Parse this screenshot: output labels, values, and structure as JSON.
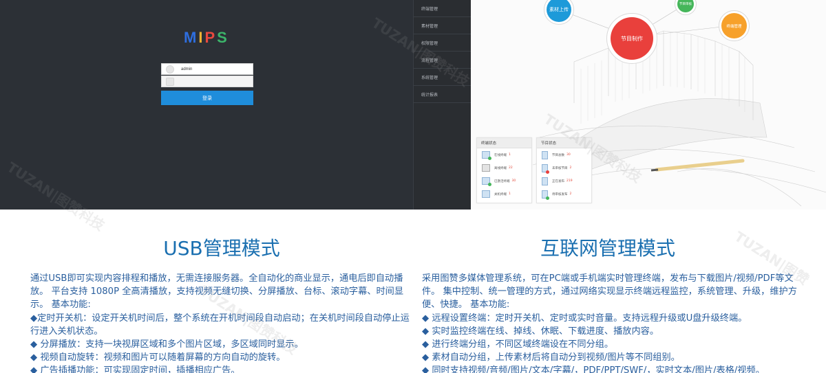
{
  "login": {
    "logo_letters": [
      "M",
      "I",
      "P",
      "S"
    ],
    "logo_colors": [
      "#2e6ee0",
      "#f2b233",
      "#e8493f",
      "#3cb56a"
    ],
    "username_value": "admin",
    "password_value": "",
    "login_button_label": "登录"
  },
  "side_menu": {
    "items": [
      {
        "label": "终端管理"
      },
      {
        "label": "素材管理"
      },
      {
        "label": "权限管理"
      },
      {
        "label": "流程管理"
      },
      {
        "label": "系统管理"
      },
      {
        "label": "统计报表"
      }
    ]
  },
  "dashboard": {
    "bubbles": {
      "material_upload": "素材上传",
      "program_make": "节目制作",
      "small_green": "节目审核",
      "publish_terminal": "终端管理"
    },
    "colors": {
      "blue": "#1d9ad9",
      "red": "#e9403c",
      "green": "#45b65a",
      "orange": "#f7a12b"
    },
    "terminal_status": {
      "title": "终端状态",
      "rows": [
        {
          "label": "在线终端",
          "count": "1"
        },
        {
          "label": "离线终端",
          "count": "22"
        },
        {
          "label": "已激活终端",
          "count": "30"
        },
        {
          "label": "关机终端",
          "count": "1"
        }
      ]
    },
    "program_status": {
      "title": "节目状态",
      "rows": [
        {
          "label": "节目总数",
          "count": "30"
        },
        {
          "label": "未审核节目",
          "count": "2"
        },
        {
          "label": "正在发布",
          "count": "219"
        },
        {
          "label": "待审核发布",
          "count": "2"
        }
      ]
    }
  },
  "left_column": {
    "title": "USB管理模式",
    "paragraphs": [
      "通过USB即可实现内容排程和播放，无需连接服务器。全自动化的商业显示，通电后即自动播放。 平台支持 1080P 全高清播放，支持视频无缝切换、分屏播放、台标、滚动字幕、时间显示。 基本功能:",
      "◆定时开关机：设定开关机时间后，整个系统在开机时间段自动启动；在关机时间段自动停止运 行进入关机状态。",
      "◆ 分屏播放：支持一块视屏区域和多个图片区域，多区域同时显示。",
      "◆ 视频自动旋转：视频和图片可以随着屏幕的方向自动的旋转。",
      "◆ 广告插播功能：可实现固定时间，插播相应广告。"
    ]
  },
  "right_column": {
    "title": "互联网管理模式",
    "paragraphs": [
      "采用图赞多媒体管理系统，可在PC端或手机端实时管理终端，发布与下载图片/视频/PDF等文件。 集中控制、统一管理的方式，通过网络实现显示终端远程监控，系统管理、升级，维护方便、快捷。 基本功能:",
      "◆ 远程设置终端：定时开关机、定时或实时音量。支持远程升级或U盘升级终端。",
      "◆ 实时监控终端在线、掉线、休眠、下载进度、播放内容。",
      "◆ 进行终端分组，不同区域终端设在不同分组。",
      "◆ 素材自动分组，上传素材后将自动分到视频/图片等不同组别。",
      "◆ 同时支持视频/音频/图片/文本/字幕/，PDF/PPT/SWF/，实时文本/图片/表格/视频。"
    ]
  },
  "watermarks": [
    "TUZAN|图赞科技",
    "TUZAN|图赞科技",
    "TUZAN|图赞科技",
    "TUZAN|图赞科技",
    "TUZAN|图赞"
  ]
}
